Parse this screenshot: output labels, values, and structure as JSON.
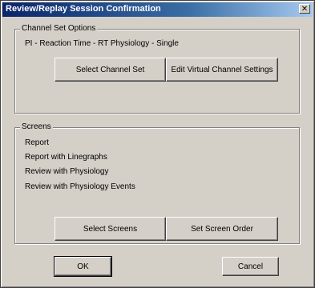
{
  "window": {
    "title": "Review/Replay Session Confirmation",
    "close_glyph": "✕"
  },
  "channel_set_options": {
    "label": "Channel Set Options",
    "current": "PI - Reaction Time - RT Physiology - Single",
    "select_button": "Select Channel Set",
    "edit_button": "Edit Virtual Channel Settings"
  },
  "screens": {
    "label": "Screens",
    "items": [
      "Report",
      "Report with Linegraphs",
      "Review with Physiology",
      "Review with Physiology Events"
    ],
    "select_button": "Select Screens",
    "order_button": "Set Screen Order"
  },
  "footer": {
    "ok_label": "OK",
    "cancel_label": "Cancel"
  }
}
